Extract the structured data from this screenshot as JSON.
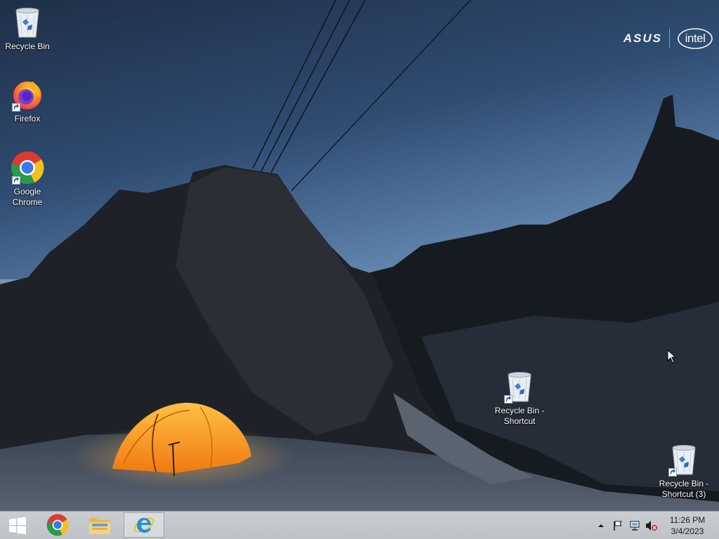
{
  "branding": {
    "vendor_logo": "ASUS",
    "chip_logo": "intel"
  },
  "desktop_icons": [
    {
      "name": "recycle-bin",
      "label": "Recycle Bin",
      "icon": "recycle-bin-icon",
      "shortcut": false
    },
    {
      "name": "firefox",
      "label": "Firefox",
      "icon": "firefox-icon",
      "shortcut": true
    },
    {
      "name": "google-chrome",
      "label": "Google\nChrome",
      "icon": "chrome-icon",
      "shortcut": true
    },
    {
      "name": "recycle-bin-shortcut",
      "label": "Recycle Bin -\nShortcut",
      "icon": "recycle-bin-icon",
      "shortcut": true
    },
    {
      "name": "recycle-bin-shortcut-3",
      "label": "Recycle Bin -\nShortcut (3)",
      "icon": "recycle-bin-icon",
      "shortcut": true
    }
  ],
  "taskbar": {
    "start": {
      "icon": "windows-logo-icon"
    },
    "pinned": [
      {
        "name": "chrome",
        "icon": "chrome-icon",
        "active": false
      },
      {
        "name": "file-explorer",
        "icon": "folder-icon",
        "active": false
      },
      {
        "name": "internet-explorer",
        "icon": "internet-explorer-icon",
        "active": true
      }
    ],
    "tray": {
      "icons": [
        "show-hidden-icons-icon",
        "action-center-flag-icon",
        "network-icon",
        "volume-muted-icon"
      ],
      "time": "11:26 PM",
      "date": "3/4/2023"
    }
  },
  "colors": {
    "taskbar_bg": "#c4c8cd",
    "sky_top": "#24364f",
    "sky_bottom": "#8fb2d4",
    "tent": "#f39a1a"
  }
}
